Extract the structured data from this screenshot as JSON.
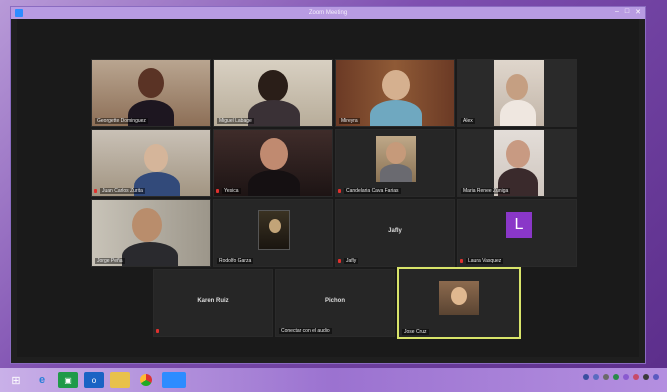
{
  "window": {
    "title": "Zoom Meeting"
  },
  "participants": [
    {
      "name": "Georgette Dominguez"
    },
    {
      "name": "Miguel Labage"
    },
    {
      "name": "Mireyra"
    },
    {
      "name": "Alex"
    },
    {
      "name": "Juan Carlos Zurita"
    },
    {
      "name": "Yesica"
    },
    {
      "name": "Candelaria Cava Farias"
    },
    {
      "name": "Maria Renee Zuniga"
    },
    {
      "name": "Jorge Peña"
    },
    {
      "name": "Rodolfo Garza"
    },
    {
      "name": "Jafly"
    },
    {
      "name": "Laura Vasquez"
    },
    {
      "name": "Karen Ruiz"
    },
    {
      "name": "Pichon"
    },
    {
      "name": "Conectar con el audio"
    },
    {
      "name": "Jose Cruz"
    }
  ],
  "tiles": {
    "jafly_label": "Jafly",
    "karen_label": "Karen Ruiz",
    "pichon_label": "Pichon",
    "laura_initial": "L"
  },
  "colors": {
    "active_speaker_border": "#d8e46a",
    "avatar_purple": "#8a37c8"
  },
  "taskbar": {
    "icons": [
      "windows-start-icon",
      "ie-icon",
      "store-icon",
      "outlook-icon",
      "file-explorer-icon",
      "chrome-icon",
      "zoom-icon"
    ]
  }
}
